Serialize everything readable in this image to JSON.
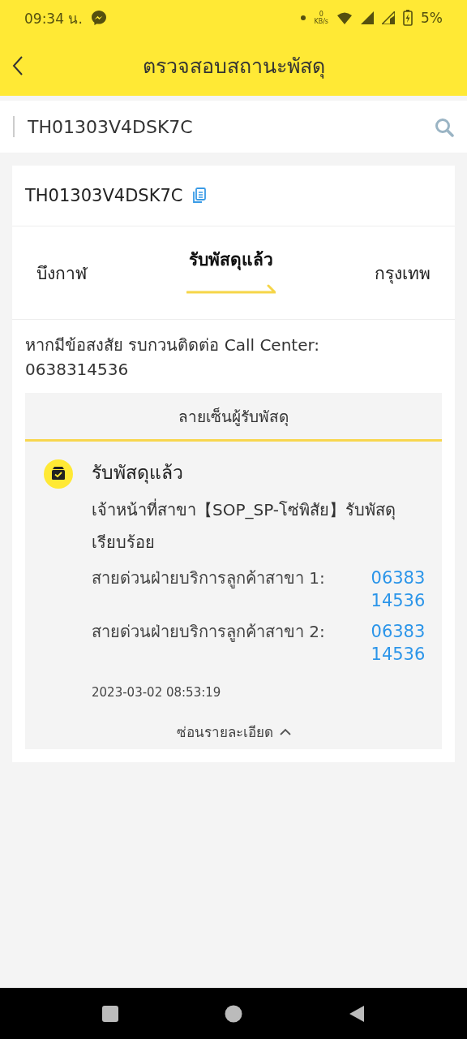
{
  "status_bar": {
    "time": "09:34 น.",
    "net_speed": "0",
    "net_unit": "KB/s",
    "battery": "5%"
  },
  "header": {
    "title": "ตรวจสอบสถานะพัสดุ"
  },
  "search": {
    "value": "TH01303V4DSK7C"
  },
  "parcel": {
    "tracking_number": "TH01303V4DSK7C",
    "route": {
      "from": "บึงกาฬ",
      "status": "รับพัสดุแล้ว",
      "to": "กรุงเทพ"
    },
    "call_center": "หากมีข้อสงสัย รบกวนติดต่อ Call Center: 0638314536",
    "details": {
      "heading": "ลายเซ็นผู้รับพัสดุ",
      "event_title": "รับพัสดุแล้ว",
      "event_text": "เจ้าหน้าที่สาขา【SOP_SP-โซ่พิสัย】รับพัสดุเรียบร้อย",
      "hotlines": [
        {
          "label": "สายด่วนฝ่ายบริการลูกค้าสาขา 1:",
          "number": "0638314536"
        },
        {
          "label": "สายด่วนฝ่ายบริการลูกค้าสาขา 2:",
          "number": "0638314536"
        }
      ],
      "time": "2023-03-02 08:53:19",
      "toggle": "ซ่อนรายละเอียด",
      "expanded": true
    }
  }
}
